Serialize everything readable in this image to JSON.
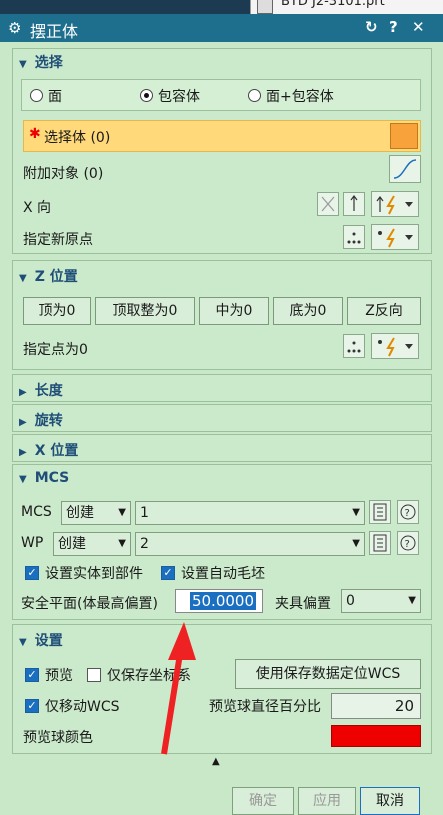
{
  "window_tab": "BTD J2-3101.prt",
  "dialog": {
    "title": "摆正体"
  },
  "select": {
    "header": "选择",
    "radios": [
      {
        "label": "面",
        "selected": false
      },
      {
        "label": "包容体",
        "selected": true
      },
      {
        "label": "面+包容体",
        "selected": false
      }
    ],
    "select_body": "选择体 (0)",
    "attach_obj": "附加对象 (0)",
    "x_dir": "X 向",
    "new_origin": "指定新原点"
  },
  "zpos": {
    "header": "Z 位置",
    "buttons": [
      "顶为0",
      "顶取整为0",
      "中为0",
      "底为0",
      "Z反向"
    ],
    "point_zero": "指定点为0"
  },
  "collapsed": [
    "长度",
    "旋转",
    "X 位置"
  ],
  "mcs": {
    "header": "MCS",
    "mcs_label": "MCS",
    "mcs_mode": "创建",
    "mcs_value": "1",
    "wp_label": "WP",
    "wp_mode": "创建",
    "wp_value": "2",
    "set_solid": "设置实体到部件",
    "set_auto_blank": "设置自动毛坯",
    "safe_plane_label": "安全平面(体最高偏置)",
    "safe_plane_value": "50.0000",
    "fixture_offset_label": "夹具偏置",
    "fixture_offset_value": "0"
  },
  "settings": {
    "header": "设置",
    "preview": "预览",
    "save_coord_only": "仅保存坐标系",
    "use_saved_btn": "使用保存数据定位WCS",
    "move_wcs_only": "仅移动WCS",
    "ball_diameter_label": "预览球直径百分比",
    "ball_diameter_value": "20",
    "ball_color_label": "预览球颜色",
    "ball_color": "#ee0000"
  },
  "footer": {
    "ok": "确定",
    "apply": "应用",
    "cancel": "取消"
  },
  "colors": {
    "titlebar": "#1e6e8e",
    "panel": "#c8e8c8",
    "highlight": "#ffd97a",
    "accent": "#1f4f78"
  }
}
